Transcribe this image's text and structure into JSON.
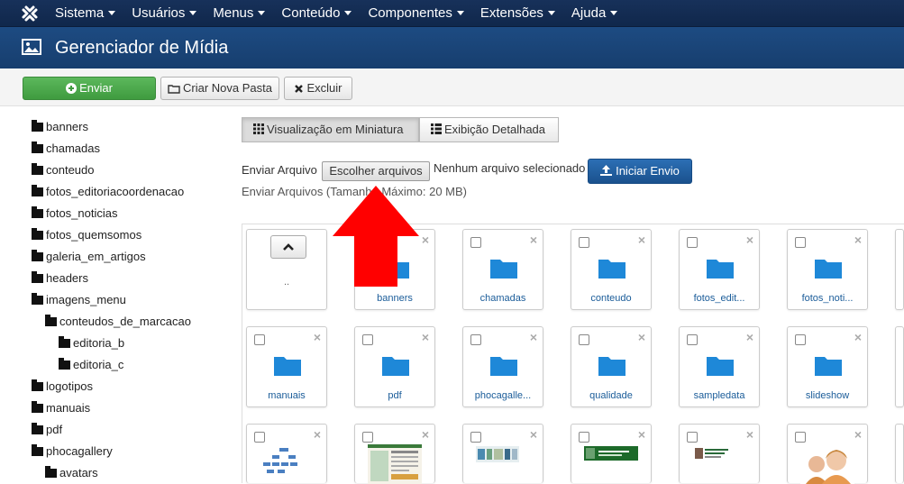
{
  "nav": {
    "items": [
      {
        "label": "Sistema"
      },
      {
        "label": "Usuários"
      },
      {
        "label": "Menus"
      },
      {
        "label": "Conteúdo"
      },
      {
        "label": "Componentes"
      },
      {
        "label": "Extensões"
      },
      {
        "label": "Ajuda"
      }
    ]
  },
  "header": {
    "title": "Gerenciador de Mídia"
  },
  "toolbar": {
    "upload_label": "Enviar",
    "new_folder_label": "Criar Nova Pasta",
    "delete_label": "Excluir"
  },
  "tree": [
    {
      "label": "banners"
    },
    {
      "label": "chamadas"
    },
    {
      "label": "conteudo"
    },
    {
      "label": "fotos_editoriacoordenacao"
    },
    {
      "label": "fotos_noticias"
    },
    {
      "label": "fotos_quemsomos"
    },
    {
      "label": "galeria_em_artigos"
    },
    {
      "label": "headers"
    },
    {
      "label": "imagens_menu"
    },
    {
      "label": "conteudos_de_marcacao"
    },
    {
      "label": "editoria_b"
    },
    {
      "label": "editoria_c"
    },
    {
      "label": "logotipos"
    },
    {
      "label": "manuais"
    },
    {
      "label": "pdf"
    },
    {
      "label": "phocagallery"
    },
    {
      "label": "avatars"
    }
  ],
  "views": {
    "thumbnail_label": "Visualização em Miniatura",
    "detail_label": "Exibição Detalhada"
  },
  "upload": {
    "send_file_label": "Enviar Arquivo",
    "choose_files_label": "Escolher arquivos",
    "no_file_label": "Nenhum arquivo selecionado",
    "start_label": "Iniciar Envio",
    "info_label": "Enviar Arquivos (Tamanho Máximo: 20 MB)"
  },
  "up_folder_label": "..",
  "thumbnails": [
    {
      "label": "banners"
    },
    {
      "label": "chamadas"
    },
    {
      "label": "conteudo"
    },
    {
      "label": "fotos_edit..."
    },
    {
      "label": "fotos_noti..."
    },
    {
      "label": "manuais"
    },
    {
      "label": "pdf"
    },
    {
      "label": "phocagalle..."
    },
    {
      "label": "qualidade"
    },
    {
      "label": "sampledata"
    },
    {
      "label": "slideshow"
    }
  ],
  "colors": {
    "navbar": "#17315a",
    "titlebar": "#1d4b82",
    "success": "#5cb85c",
    "primary": "#2c6fb5",
    "folder": "#1e88d8",
    "arrow": "#ff0000"
  }
}
